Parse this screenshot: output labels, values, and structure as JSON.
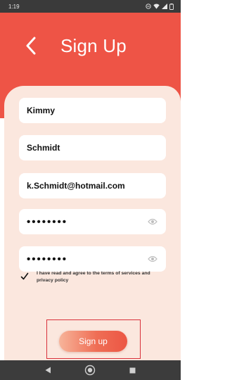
{
  "status_bar": {
    "time": "1:19",
    "icons": [
      "do-not-disturb-icon",
      "wifi-icon",
      "signal-icon",
      "battery-icon"
    ]
  },
  "header": {
    "title": "Sign Up",
    "back_icon": "chevron-left-icon",
    "color": "#ee5446"
  },
  "form": {
    "first_name": {
      "value": "Kimmy"
    },
    "last_name": {
      "value": "Schmidt"
    },
    "email": {
      "value": "k.Schmidt@hotmail.com"
    },
    "password": {
      "value": "••••••••",
      "icon": "eye-icon"
    },
    "confirm_password": {
      "value": "••••••••",
      "icon": "eye-icon"
    },
    "terms": {
      "checked": true,
      "label": "I have read and agree to the terms of services and privacy policy"
    },
    "submit_label": "Sign up"
  },
  "nav_bar": {
    "buttons": [
      "back-triangle-icon",
      "home-circle-icon",
      "recents-square-icon"
    ]
  },
  "colors": {
    "accent": "#ee5446",
    "card": "#fbe7de",
    "highlight": "#d8303a"
  }
}
